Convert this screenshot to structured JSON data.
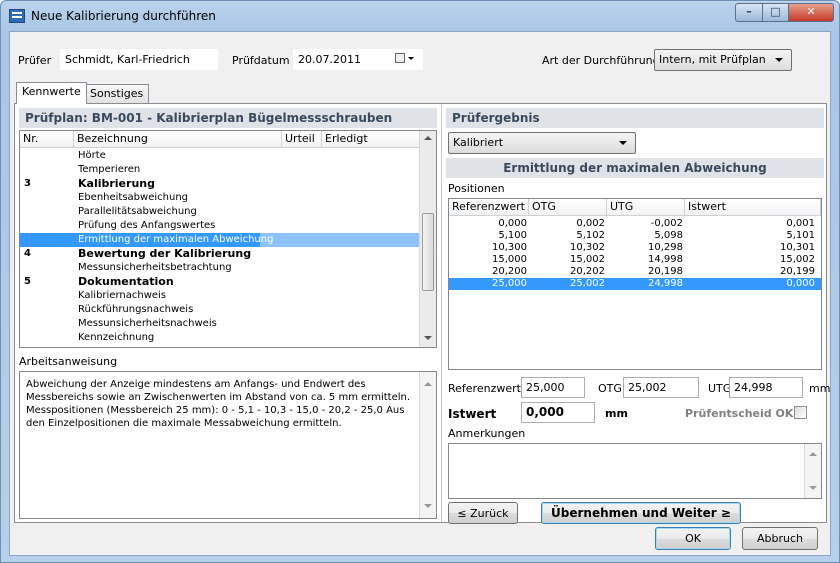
{
  "window": {
    "title": "Neue Kalibrierung durchführen"
  },
  "header": {
    "pruefer_label": "Prüfer",
    "pruefer_value": "Schmidt, Karl-Friedrich",
    "pruefdatum_label": "Prüfdatum",
    "pruefdatum_value": "20.07.2011",
    "art_label": "Art der Durchführung",
    "art_value": "Intern, mit Prüfplan"
  },
  "tabs": [
    "Kennwerte",
    "Sonstiges"
  ],
  "pruefplan": {
    "title": "Prüfplan: BM-001 - Kalibrierplan Bügelmessschrauben",
    "columns": [
      "Nr.",
      "Bezeichnung",
      "Urteil",
      "Erledigt"
    ],
    "rows": [
      {
        "nr": "",
        "label": "Hörte",
        "bold": false
      },
      {
        "nr": "",
        "label": "Temperieren",
        "bold": false
      },
      {
        "nr": "3",
        "label": "Kalibrierung",
        "bold": true
      },
      {
        "nr": "",
        "label": "Ebenheitsabweichung",
        "bold": false
      },
      {
        "nr": "",
        "label": "Parallelitätsabweichung",
        "bold": false
      },
      {
        "nr": "",
        "label": "Prüfung des Anfangswertes",
        "bold": false
      },
      {
        "nr": "",
        "label": "Ermittlung der maximalen Abweichung",
        "bold": false,
        "selected": true
      },
      {
        "nr": "4",
        "label": "Bewertung der Kalibrierung",
        "bold": true
      },
      {
        "nr": "",
        "label": "Messunsicherheitsbetrachtung",
        "bold": false
      },
      {
        "nr": "5",
        "label": "Dokumentation",
        "bold": true
      },
      {
        "nr": "",
        "label": "Kalibriernachweis",
        "bold": false
      },
      {
        "nr": "",
        "label": "Rückführungsnachweis",
        "bold": false
      },
      {
        "nr": "",
        "label": "Messunsicherheitsnachweis",
        "bold": false
      },
      {
        "nr": "",
        "label": "Kennzeichnung",
        "bold": false
      }
    ]
  },
  "arbeitsanweisung": {
    "label": "Arbeitsanweisung",
    "text": "Abweichung der Anzeige mindestens am Anfangs- und Endwert des Messbereichs sowie an Zwischenwerten im Abstand von ca. 5 mm ermitteln. Messpositionen (Messbereich 25 mm): 0 - 5,1 - 10,3 - 15,0 - 20,2 - 25,0 Aus den Einzelpositionen die maximale Messabweichung ermitteln."
  },
  "pruefergebnis": {
    "title": "Prüfergebnis",
    "status": "Kalibriert",
    "section_title": "Ermittlung der maximalen Abweichung",
    "positionen_label": "Positionen",
    "columns": [
      "Referenzwert",
      "OTG",
      "UTG",
      "Istwert"
    ],
    "rows": [
      [
        "0,000",
        "0,002",
        "-0,002",
        "0,001"
      ],
      [
        "5,100",
        "5,102",
        "5,098",
        "5,101"
      ],
      [
        "10,300",
        "10,302",
        "10,298",
        "10,301"
      ],
      [
        "15,000",
        "15,002",
        "14,998",
        "15,002"
      ],
      [
        "20,200",
        "20,202",
        "20,198",
        "20,199"
      ],
      [
        "25,000",
        "25,002",
        "24,998",
        "0,000"
      ]
    ],
    "selected_row": 5,
    "referenzwert_label": "Referenzwert",
    "referenzwert_value": "25,000",
    "otg_label": "OTG",
    "otg_value": "25,002",
    "utg_label": "UTG",
    "utg_value": "24,998",
    "mm": "mm",
    "istwert_label": "Istwert",
    "istwert_value": "0,000",
    "istwert_unit": "mm",
    "pruefentscheid_label": "Prüfentscheid OK?",
    "anmerkungen_label": "Anmerkungen"
  },
  "buttons": {
    "zurueck": "≤ Zurück",
    "weiter": "Übernehmen und Weiter ≥",
    "ok": "OK",
    "abbruch": "Abbruch"
  }
}
